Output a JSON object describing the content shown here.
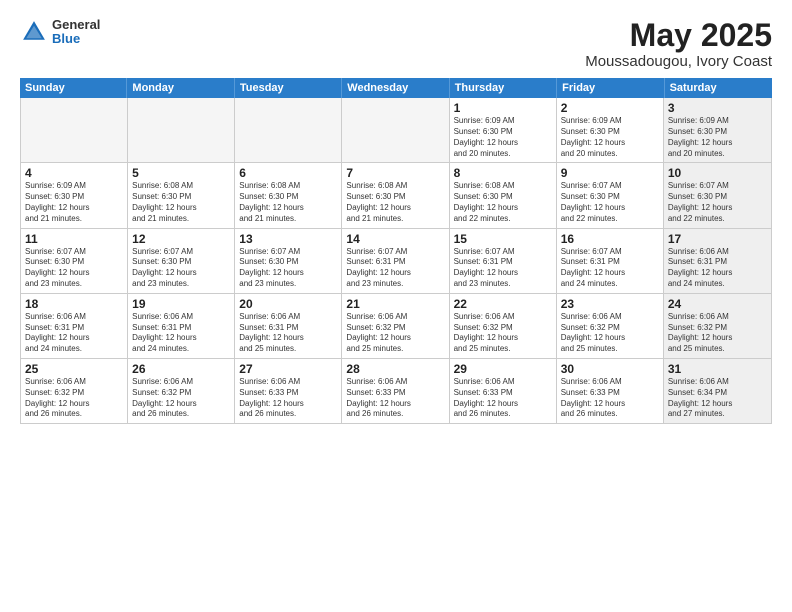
{
  "header": {
    "title": "May 2025",
    "subtitle": "Moussadougou, Ivory Coast",
    "logo_general": "General",
    "logo_blue": "Blue"
  },
  "days_of_week": [
    "Sunday",
    "Monday",
    "Tuesday",
    "Wednesday",
    "Thursday",
    "Friday",
    "Saturday"
  ],
  "weeks": [
    [
      {
        "day": "",
        "info": "",
        "shaded": true
      },
      {
        "day": "",
        "info": "",
        "shaded": true
      },
      {
        "day": "",
        "info": "",
        "shaded": true
      },
      {
        "day": "",
        "info": "",
        "shaded": true
      },
      {
        "day": "1",
        "info": "Sunrise: 6:09 AM\nSunset: 6:30 PM\nDaylight: 12 hours\nand 20 minutes.",
        "shaded": false
      },
      {
        "day": "2",
        "info": "Sunrise: 6:09 AM\nSunset: 6:30 PM\nDaylight: 12 hours\nand 20 minutes.",
        "shaded": false
      },
      {
        "day": "3",
        "info": "Sunrise: 6:09 AM\nSunset: 6:30 PM\nDaylight: 12 hours\nand 20 minutes.",
        "shaded": true
      }
    ],
    [
      {
        "day": "4",
        "info": "Sunrise: 6:09 AM\nSunset: 6:30 PM\nDaylight: 12 hours\nand 21 minutes.",
        "shaded": false
      },
      {
        "day": "5",
        "info": "Sunrise: 6:08 AM\nSunset: 6:30 PM\nDaylight: 12 hours\nand 21 minutes.",
        "shaded": false
      },
      {
        "day": "6",
        "info": "Sunrise: 6:08 AM\nSunset: 6:30 PM\nDaylight: 12 hours\nand 21 minutes.",
        "shaded": false
      },
      {
        "day": "7",
        "info": "Sunrise: 6:08 AM\nSunset: 6:30 PM\nDaylight: 12 hours\nand 21 minutes.",
        "shaded": false
      },
      {
        "day": "8",
        "info": "Sunrise: 6:08 AM\nSunset: 6:30 PM\nDaylight: 12 hours\nand 22 minutes.",
        "shaded": false
      },
      {
        "day": "9",
        "info": "Sunrise: 6:07 AM\nSunset: 6:30 PM\nDaylight: 12 hours\nand 22 minutes.",
        "shaded": false
      },
      {
        "day": "10",
        "info": "Sunrise: 6:07 AM\nSunset: 6:30 PM\nDaylight: 12 hours\nand 22 minutes.",
        "shaded": true
      }
    ],
    [
      {
        "day": "11",
        "info": "Sunrise: 6:07 AM\nSunset: 6:30 PM\nDaylight: 12 hours\nand 23 minutes.",
        "shaded": false
      },
      {
        "day": "12",
        "info": "Sunrise: 6:07 AM\nSunset: 6:30 PM\nDaylight: 12 hours\nand 23 minutes.",
        "shaded": false
      },
      {
        "day": "13",
        "info": "Sunrise: 6:07 AM\nSunset: 6:30 PM\nDaylight: 12 hours\nand 23 minutes.",
        "shaded": false
      },
      {
        "day": "14",
        "info": "Sunrise: 6:07 AM\nSunset: 6:31 PM\nDaylight: 12 hours\nand 23 minutes.",
        "shaded": false
      },
      {
        "day": "15",
        "info": "Sunrise: 6:07 AM\nSunset: 6:31 PM\nDaylight: 12 hours\nand 23 minutes.",
        "shaded": false
      },
      {
        "day": "16",
        "info": "Sunrise: 6:07 AM\nSunset: 6:31 PM\nDaylight: 12 hours\nand 24 minutes.",
        "shaded": false
      },
      {
        "day": "17",
        "info": "Sunrise: 6:06 AM\nSunset: 6:31 PM\nDaylight: 12 hours\nand 24 minutes.",
        "shaded": true
      }
    ],
    [
      {
        "day": "18",
        "info": "Sunrise: 6:06 AM\nSunset: 6:31 PM\nDaylight: 12 hours\nand 24 minutes.",
        "shaded": false
      },
      {
        "day": "19",
        "info": "Sunrise: 6:06 AM\nSunset: 6:31 PM\nDaylight: 12 hours\nand 24 minutes.",
        "shaded": false
      },
      {
        "day": "20",
        "info": "Sunrise: 6:06 AM\nSunset: 6:31 PM\nDaylight: 12 hours\nand 25 minutes.",
        "shaded": false
      },
      {
        "day": "21",
        "info": "Sunrise: 6:06 AM\nSunset: 6:32 PM\nDaylight: 12 hours\nand 25 minutes.",
        "shaded": false
      },
      {
        "day": "22",
        "info": "Sunrise: 6:06 AM\nSunset: 6:32 PM\nDaylight: 12 hours\nand 25 minutes.",
        "shaded": false
      },
      {
        "day": "23",
        "info": "Sunrise: 6:06 AM\nSunset: 6:32 PM\nDaylight: 12 hours\nand 25 minutes.",
        "shaded": false
      },
      {
        "day": "24",
        "info": "Sunrise: 6:06 AM\nSunset: 6:32 PM\nDaylight: 12 hours\nand 25 minutes.",
        "shaded": true
      }
    ],
    [
      {
        "day": "25",
        "info": "Sunrise: 6:06 AM\nSunset: 6:32 PM\nDaylight: 12 hours\nand 26 minutes.",
        "shaded": false
      },
      {
        "day": "26",
        "info": "Sunrise: 6:06 AM\nSunset: 6:32 PM\nDaylight: 12 hours\nand 26 minutes.",
        "shaded": false
      },
      {
        "day": "27",
        "info": "Sunrise: 6:06 AM\nSunset: 6:33 PM\nDaylight: 12 hours\nand 26 minutes.",
        "shaded": false
      },
      {
        "day": "28",
        "info": "Sunrise: 6:06 AM\nSunset: 6:33 PM\nDaylight: 12 hours\nand 26 minutes.",
        "shaded": false
      },
      {
        "day": "29",
        "info": "Sunrise: 6:06 AM\nSunset: 6:33 PM\nDaylight: 12 hours\nand 26 minutes.",
        "shaded": false
      },
      {
        "day": "30",
        "info": "Sunrise: 6:06 AM\nSunset: 6:33 PM\nDaylight: 12 hours\nand 26 minutes.",
        "shaded": false
      },
      {
        "day": "31",
        "info": "Sunrise: 6:06 AM\nSunset: 6:34 PM\nDaylight: 12 hours\nand 27 minutes.",
        "shaded": true
      }
    ]
  ]
}
